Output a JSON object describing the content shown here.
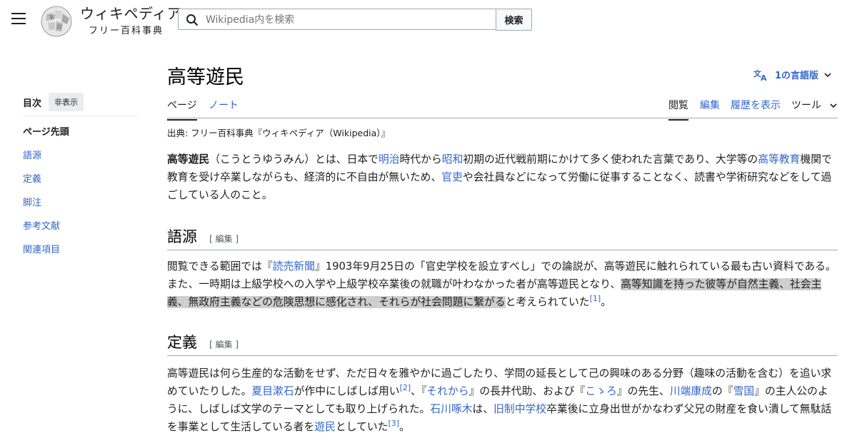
{
  "header": {
    "wordmark_title": "ウィキペディア",
    "wordmark_tagline": "フリー百科事典",
    "search_placeholder": "Wikipedia内を検索",
    "search_button": "検索"
  },
  "toc": {
    "title": "目次",
    "hide": "非表示",
    "items": [
      "ページ先頭",
      "語源",
      "定義",
      "脚注",
      "参考文献",
      "関連項目"
    ]
  },
  "article": {
    "title": "高等遊民",
    "languages": "1の言語版",
    "tabs_left": [
      "ページ",
      "ノート"
    ],
    "tabs_right": [
      "閲覧",
      "編集",
      "履歴を表示",
      "ツール"
    ],
    "from": "出典: フリー百科事典『ウィキペディア（Wikipedia）』",
    "lead": {
      "bold": "高等遊民",
      "t1": "（こうとうゆうみん）とは、日本で",
      "l1": "明治",
      "t2": "時代から",
      "l2": "昭和",
      "t3": "初期の近代戦前期にかけて多く使われた言葉であり、大学等の",
      "l3": "高等教育",
      "t4": "機関で教育を受け卒業しながらも、経済的に不自由が無いため、",
      "l4": "官吏",
      "t5": "や会社員などになって労働に従事することなく、読書や学術研究などをして過ごしている人のこと。"
    },
    "sections": [
      {
        "heading": "語源",
        "edit": "[ 編集 ]",
        "t1": "閲覧できる範囲では『",
        "l1": "読売新聞",
        "t2": "』1903年9月25日の「官史学校を設立すべし」での論説が、高等遊民に触れられている最も古い資料である。また、一時期は上級学校への入学や上級学校卒業後の就職が叶わなかった者が高等遊民となり、",
        "hl": "高等知識を持った彼等が自然主義、社会主義、無政府主義などの危険思想に感化され、それらが社会問題に繋がる",
        "t3": "と考えられていた",
        "ref": "[1]",
        "t4": "。"
      },
      {
        "heading": "定義",
        "edit": "[ 編集 ]",
        "t1": "高等遊民は何ら生産的な活動をせず、ただ日々を雅やかに過ごしたり、学問の延長として己の興味のある分野（趣味の活動を含む）を追い求めていたりした。",
        "l1": "夏目漱石",
        "t2": "が作中にしばしば用い",
        "ref1": "[2]",
        "t3": "、『",
        "l2": "それから",
        "t4": "』の長井代助、および『",
        "l3": "こゝろ",
        "t5": "』の先生、",
        "l4": "川端康成",
        "t6": "の『",
        "l5": "雪国",
        "t7": "』の主人公のように、しばしば文学のテーマとしても取り上げられた。",
        "l6": "石川啄木",
        "t8": "は、",
        "l7": "旧制中学校",
        "t9": "卒業後に立身出世がかなわず父兄の財産を食い潰して無駄話を事業として生活している者を",
        "l8": "遊民",
        "t10": "としていた",
        "ref2": "[3]",
        "t11": "。"
      }
    ]
  },
  "colors": {
    "link": "#3366cc",
    "text": "#202122",
    "highlight": "#cfcfcf"
  }
}
